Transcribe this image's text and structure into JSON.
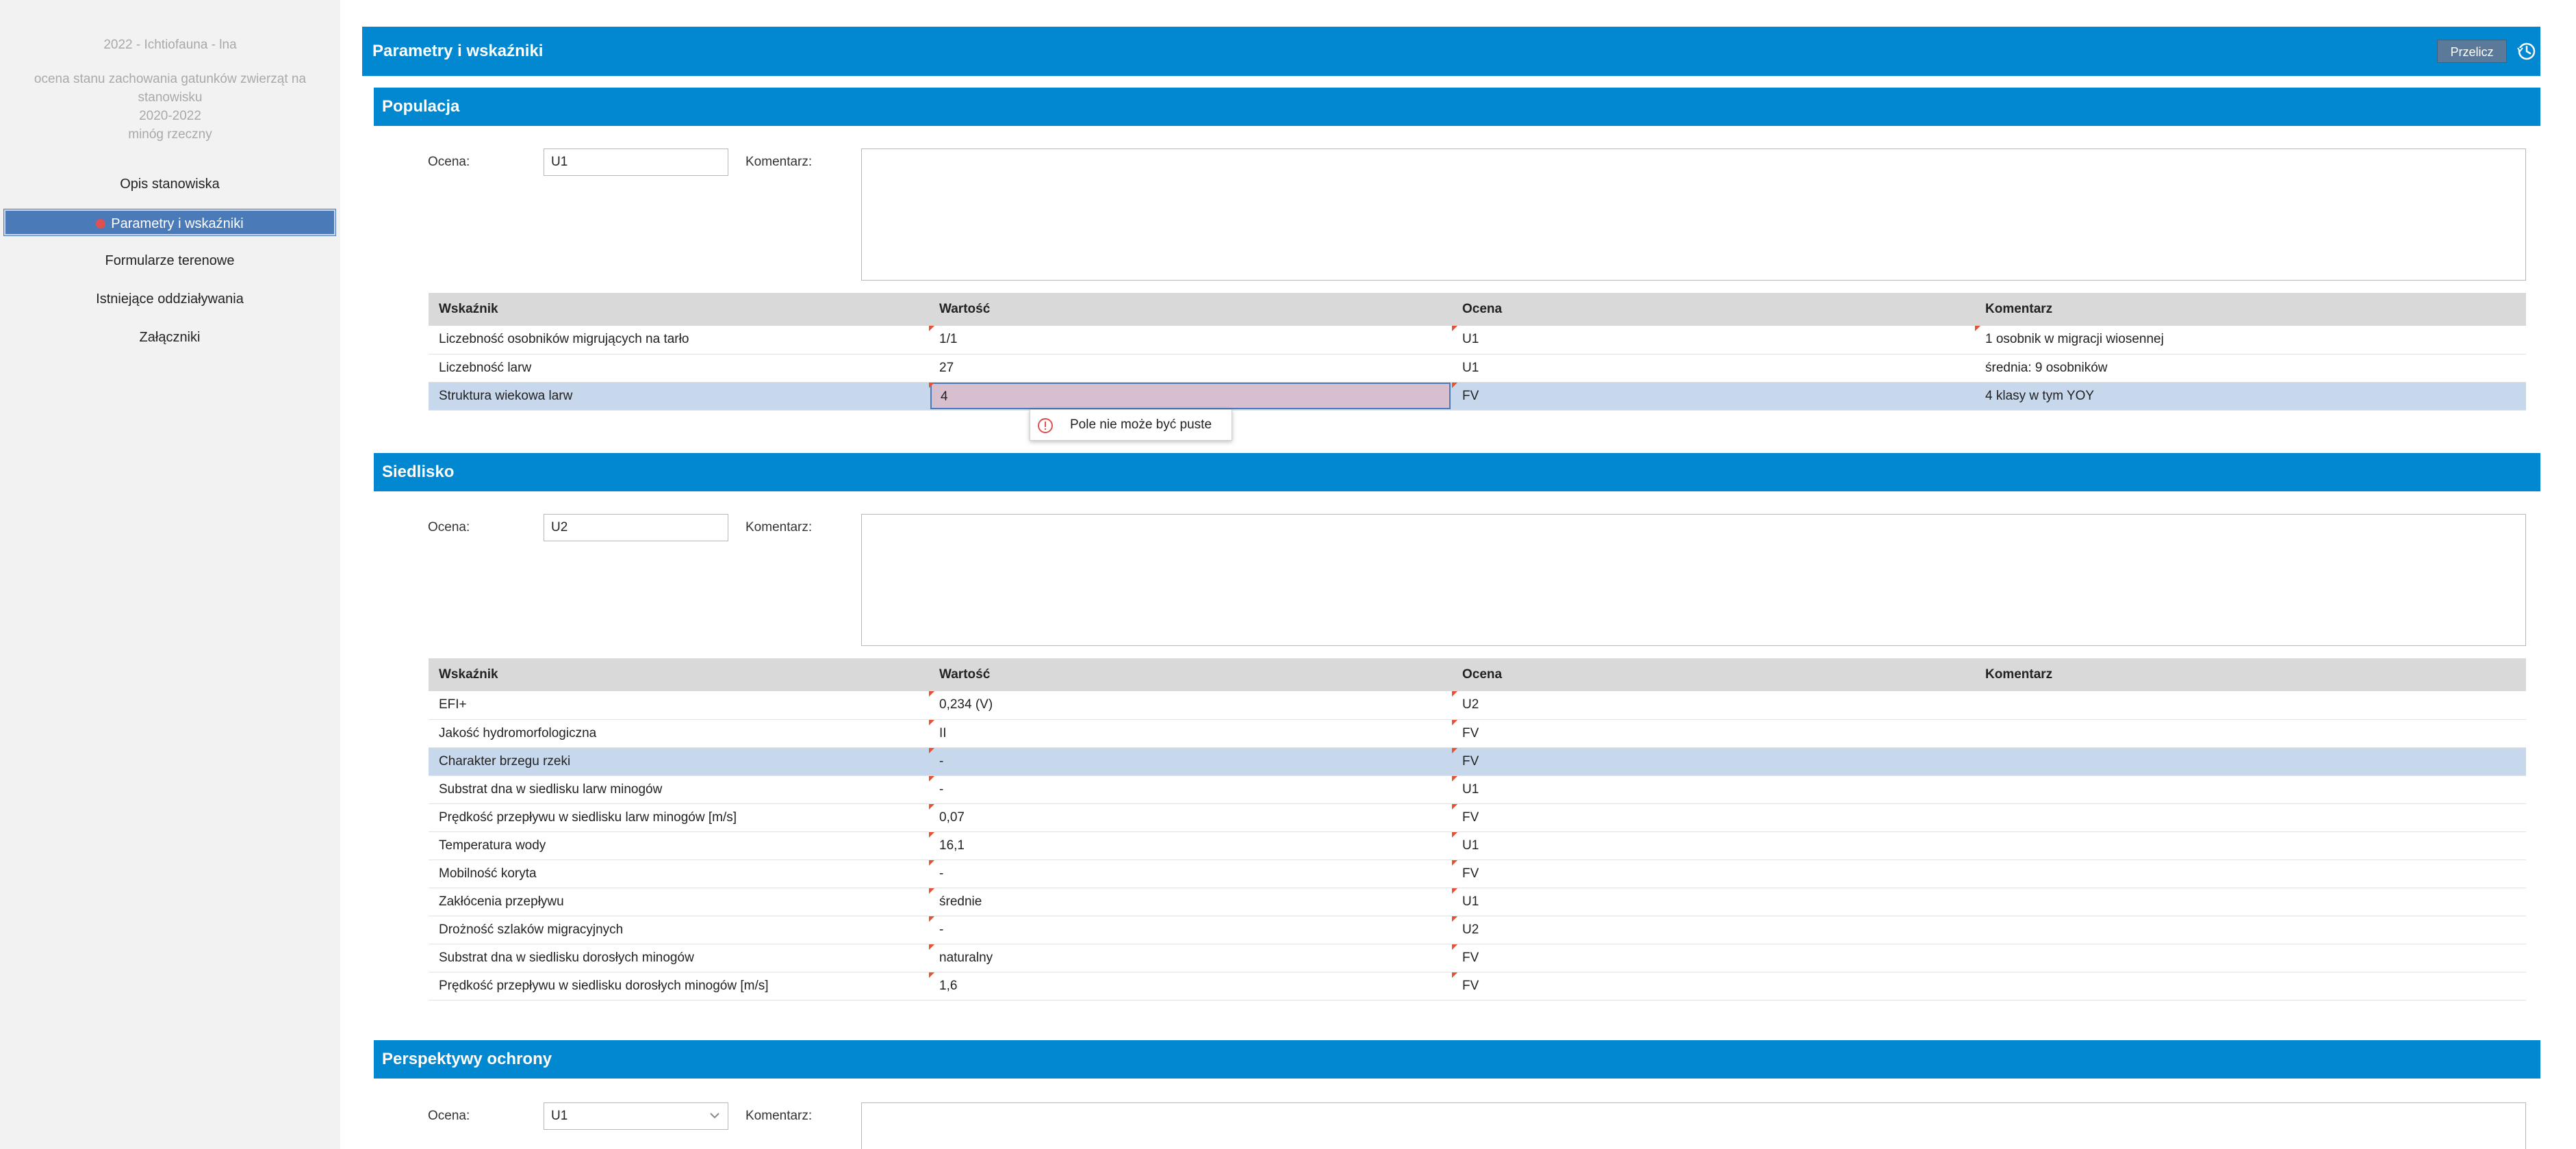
{
  "sidebar": {
    "year_line": "2022 - Ichtiofauna - lna",
    "desc_lines": [
      "ocena stanu zachowania gatunków zwierząt na stanowisku",
      "2020-2022",
      "minóg rzeczny"
    ],
    "nav": [
      {
        "label": "Opis stanowiska"
      },
      {
        "label": "Parametry i wskaźniki"
      },
      {
        "label": "Formularze terenowe"
      },
      {
        "label": "Istniejące oddziaływania"
      },
      {
        "label": "Załączniki"
      }
    ]
  },
  "topbar": {
    "title": "Parametry i wskaźniki",
    "recalc_label": "Przelicz",
    "history_icon": "history-icon"
  },
  "labels": {
    "ocena": "Ocena:",
    "komentarz": "Komentarz:",
    "col_wskaznik": "Wskaźnik",
    "col_wartosc": "Wartość",
    "col_ocena": "Ocena",
    "col_komentarz": "Komentarz"
  },
  "populacja": {
    "title": "Populacja",
    "ocena": "U1",
    "komentarz": "",
    "rows": [
      {
        "wskaznik": "Liczebność osobników migrujących na tarło",
        "wartosc": "1/1",
        "ocena": "U1",
        "komentarz": "1 osobnik w migracji wiosennej"
      },
      {
        "wskaznik": "Liczebność larw",
        "wartosc": "27",
        "ocena": "U1",
        "komentarz": "średnia: 9 osobników"
      },
      {
        "wskaznik": "Struktura wiekowa larw",
        "wartosc": "4",
        "ocena": "FV",
        "komentarz": "4 klasy w tym YOY"
      }
    ]
  },
  "tooltip": {
    "message": "Pole nie może być puste"
  },
  "siedlisko": {
    "title": "Siedlisko",
    "ocena": "U2",
    "komentarz": "",
    "rows": [
      {
        "wskaznik": "EFI+",
        "wartosc": "0,234 (V)",
        "ocena": "U2",
        "komentarz": ""
      },
      {
        "wskaznik": "Jakość hydromorfologiczna",
        "wartosc": "II",
        "ocena": "FV",
        "komentarz": ""
      },
      {
        "wskaznik": "Charakter brzegu rzeki",
        "wartosc": "-",
        "ocena": "FV",
        "komentarz": ""
      },
      {
        "wskaznik": "Substrat dna w siedlisku larw minogów",
        "wartosc": "-",
        "ocena": "U1",
        "komentarz": ""
      },
      {
        "wskaznik": "Prędkość przepływu w siedlisku larw minogów [m/s]",
        "wartosc": "0,07",
        "ocena": "FV",
        "komentarz": ""
      },
      {
        "wskaznik": "Temperatura wody",
        "wartosc": "16,1",
        "ocena": "U1",
        "komentarz": ""
      },
      {
        "wskaznik": "Mobilność koryta",
        "wartosc": "-",
        "ocena": "FV",
        "komentarz": ""
      },
      {
        "wskaznik": "Zakłócenia przepływu",
        "wartosc": "średnie",
        "ocena": "U1",
        "komentarz": ""
      },
      {
        "wskaznik": "Drożność szlaków migracyjnych",
        "wartosc": "-",
        "ocena": "U2",
        "komentarz": ""
      },
      {
        "wskaznik": "Substrat dna w siedlisku dorosłych minogów",
        "wartosc": "naturalny",
        "ocena": "FV",
        "komentarz": ""
      },
      {
        "wskaznik": "Prędkość przepływu w siedlisku dorosłych minogów [m/s]",
        "wartosc": "1,6",
        "ocena": "FV",
        "komentarz": ""
      }
    ]
  },
  "perspektywy": {
    "title": "Perspektywy ochrony",
    "ocena": "U1"
  },
  "colors": {
    "header_blue": "#0288d1",
    "selected_row": "#c8d8ec",
    "nav_active": "#4a7ab8",
    "edit_cell": "#d8bfd0",
    "error": "#e05050"
  }
}
